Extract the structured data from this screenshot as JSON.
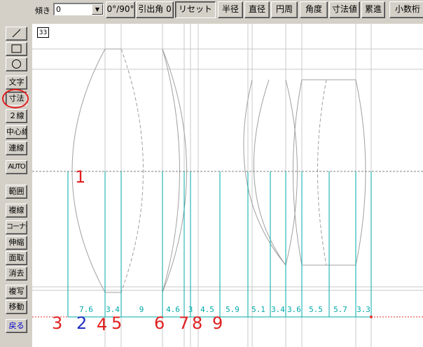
{
  "toolbar": {
    "tilt_label": "傾き",
    "tilt_value": "0",
    "buttons": [
      "0°/90°",
      "引出角 0",
      "リセット",
      "半径",
      "直径",
      "円周",
      "角度",
      "寸法値",
      "累進",
      "小数桁"
    ]
  },
  "palette": {
    "items": [
      "文字",
      "寸法",
      "２線",
      "中心線",
      "連線",
      "AUTO",
      "範囲",
      "複線",
      "コーナー",
      "伸縮",
      "面取",
      "消去",
      "複写",
      "移動",
      "戻る"
    ]
  },
  "canvas": {
    "scale": "33",
    "dimension_labels": [
      "7.6",
      "3.4",
      "9",
      "4.6",
      "3",
      "4.5",
      "5.9",
      "5.1",
      "3.4",
      "3.6",
      "5.5",
      "5.7",
      "3.3"
    ],
    "annotations": [
      {
        "text": "1",
        "color": "#e02020"
      },
      {
        "text": "3",
        "color": "#e02020"
      },
      {
        "text": "2",
        "color": "#2030c0"
      },
      {
        "text": "4",
        "color": "#e02020"
      },
      {
        "text": "5",
        "color": "#e02020"
      },
      {
        "text": "6",
        "color": "#e02020"
      },
      {
        "text": "7",
        "color": "#e02020"
      },
      {
        "text": "8",
        "color": "#e02020"
      },
      {
        "text": "9",
        "color": "#e02020"
      }
    ]
  },
  "colors": {
    "dimension_line": "#00aaaa",
    "axis_line": "#e03030",
    "construction_line": "#c8c8c8",
    "lens_outline": "#a0a0a0",
    "highlight": "#e02020"
  }
}
